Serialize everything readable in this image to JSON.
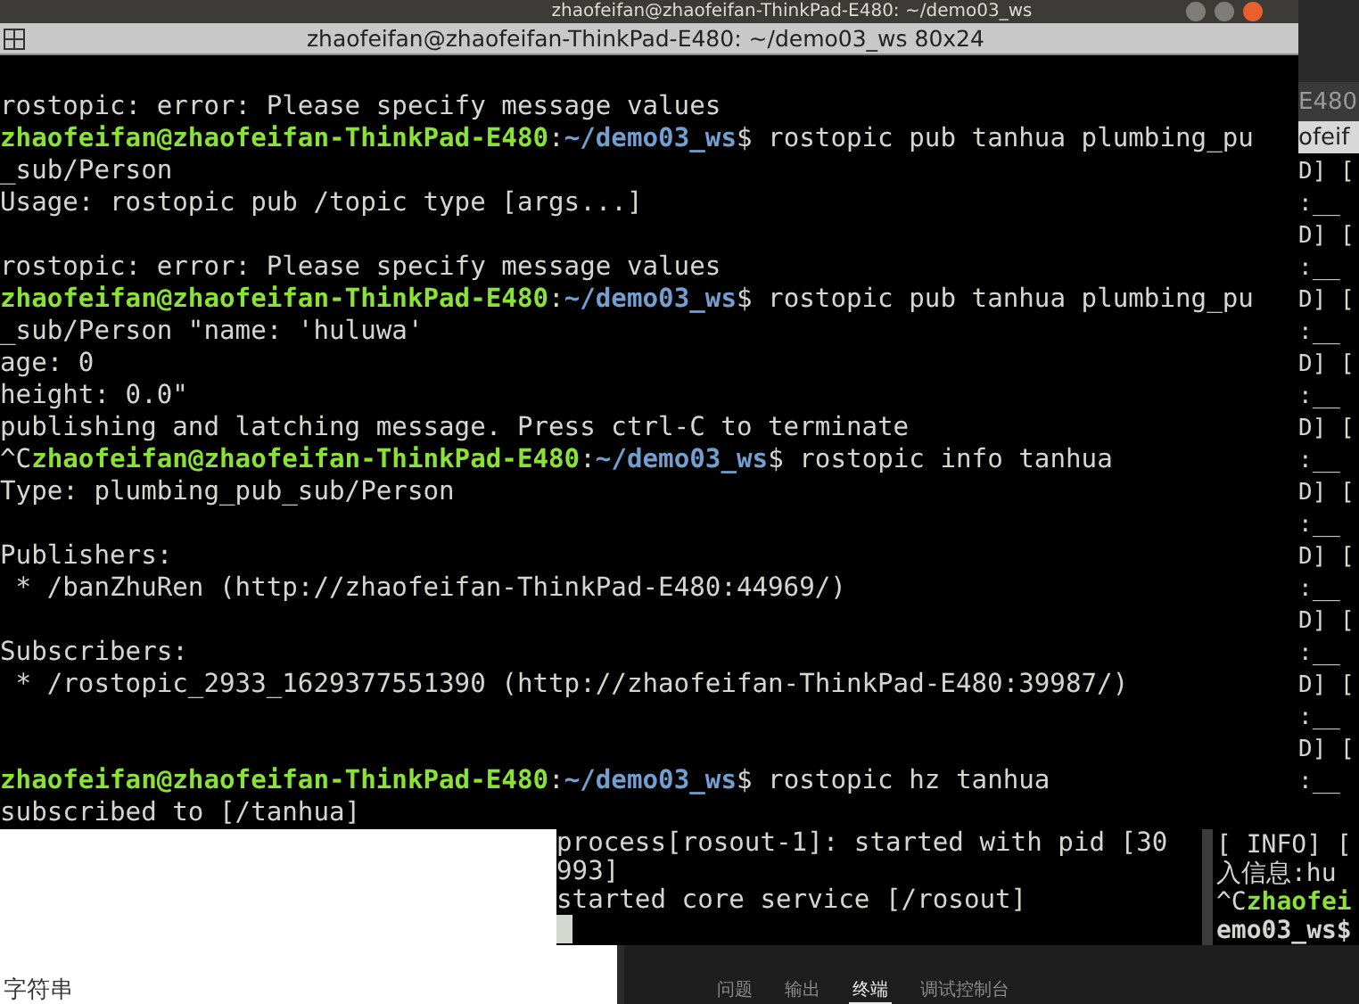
{
  "back_window": {
    "title": "zhaofeifan@zhaofeifan-ThinkPad-E480: ~/demo03_ws"
  },
  "main_terminal": {
    "title": "zhaofeifan@zhaofeifan-ThinkPad-E480: ~/demo03_ws 80x24",
    "lines": [
      {
        "kind": "output",
        "text": "rostopic: error: Please specify message values"
      },
      {
        "kind": "prompt",
        "user": "zhaofeifan@zhaofeifan-ThinkPad-E480",
        "sep": ":",
        "path": "~/demo03_ws",
        "command": "$ rostopic pub tanhua plumbing_pu"
      },
      {
        "kind": "output",
        "text": "_sub/Person"
      },
      {
        "kind": "output",
        "text": "Usage: rostopic pub /topic type [args...]"
      },
      {
        "kind": "blank"
      },
      {
        "kind": "output",
        "text": "rostopic: error: Please specify message values"
      },
      {
        "kind": "prompt",
        "user": "zhaofeifan@zhaofeifan-ThinkPad-E480",
        "sep": ":",
        "path": "~/demo03_ws",
        "command": "$ rostopic pub tanhua plumbing_pu"
      },
      {
        "kind": "output",
        "text": "_sub/Person \"name: 'huluwa'"
      },
      {
        "kind": "output",
        "text": "age: 0"
      },
      {
        "kind": "output",
        "text": "height: 0.0\""
      },
      {
        "kind": "output",
        "text": "publishing and latching message. Press ctrl-C to terminate"
      },
      {
        "kind": "prompt",
        "prefix": "^C",
        "user": "zhaofeifan@zhaofeifan-ThinkPad-E480",
        "sep": ":",
        "path": "~/demo03_ws",
        "command": "$ rostopic info tanhua"
      },
      {
        "kind": "output",
        "text": "Type: plumbing_pub_sub/Person"
      },
      {
        "kind": "blank"
      },
      {
        "kind": "output",
        "text": "Publishers:"
      },
      {
        "kind": "output",
        "text": " * /banZhuRen (http://zhaofeifan-ThinkPad-E480:44969/)"
      },
      {
        "kind": "blank"
      },
      {
        "kind": "output",
        "text": "Subscribers:"
      },
      {
        "kind": "output",
        "text": " * /rostopic_2933_1629377551390 (http://zhaofeifan-ThinkPad-E480:39987/)"
      },
      {
        "kind": "blank"
      },
      {
        "kind": "blank"
      },
      {
        "kind": "prompt",
        "user": "zhaofeifan@zhaofeifan-ThinkPad-E480",
        "sep": ":",
        "path": "~/demo03_ws",
        "command": "$ rostopic hz tanhua"
      },
      {
        "kind": "output",
        "text": "subscribed to [/tanhua]"
      }
    ]
  },
  "right_terminal": {
    "tab": "E480",
    "title": "ofeif",
    "upper_lines": [
      "D] [",
      ":__",
      "D] [",
      ":__",
      "D] [",
      ":__",
      "D] [",
      ":__",
      "D] [",
      ":__",
      "D] [",
      ":__",
      "D] [",
      ":__",
      "D] [",
      ":__",
      "D] [",
      ":__",
      "D] [",
      ":__"
    ],
    "lower_lines": [
      {
        "kind": "output",
        "text": "[ INFO] ["
      },
      {
        "kind": "output",
        "text": "入信息:hu"
      },
      {
        "kind": "prompt",
        "prefix": "^C",
        "user": "zhaofei"
      },
      {
        "kind": "path",
        "text": "emo03_ws$"
      }
    ]
  },
  "roslaunch_terminal": {
    "lines": [
      "process[rosout-1]: started with pid [30",
      "993]",
      "started core service [/rosout]"
    ]
  },
  "editor_panel": {
    "text": "字符串"
  },
  "bottom_panel": {
    "tabs": [
      {
        "label": "问题",
        "selected": false
      },
      {
        "label": "输出",
        "selected": false
      },
      {
        "label": "终端",
        "selected": true
      },
      {
        "label": "调试控制台",
        "selected": false
      }
    ]
  }
}
